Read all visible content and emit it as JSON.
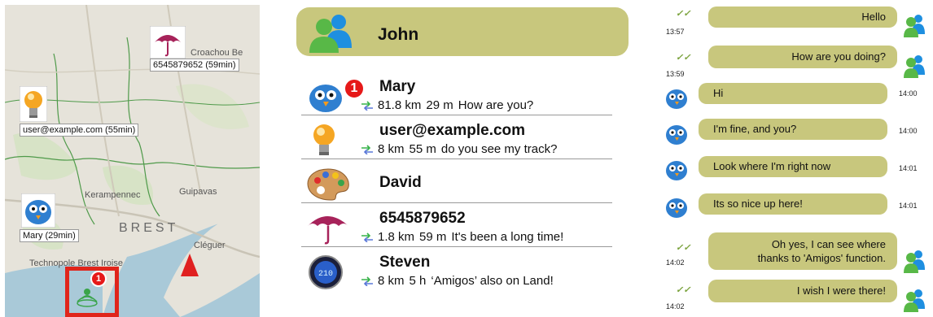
{
  "map": {
    "place_labels": [
      "Croachou Be",
      "Kerampennec",
      "Guipavas",
      "Cléguer",
      "Technopole Brest Iroise"
    ],
    "city": "BREST",
    "pins": [
      {
        "label": "6545879652 (59min)",
        "icon": "umbrella-icon"
      },
      {
        "label": "user@example.com (55min)",
        "icon": "lightbulb-icon"
      },
      {
        "label": "Mary (29min)",
        "icon": "bird-icon"
      }
    ],
    "selected_badge": "1",
    "colors": {
      "accent_red": "#e0251b",
      "border_green": "#2f8a3a"
    }
  },
  "contacts": {
    "header_name": "John",
    "items": [
      {
        "name": "Mary",
        "distance": "81.8 km",
        "time": "29 m",
        "message": "How are you?",
        "badge": "1",
        "icon": "bird-icon"
      },
      {
        "name": "user@example.com",
        "distance": "8 km",
        "time": "55 m",
        "message": "do you see my track?",
        "icon": "lightbulb-icon"
      },
      {
        "name": "David",
        "distance": "",
        "time": "",
        "message": "",
        "icon": "palette-icon"
      },
      {
        "name": "6545879652",
        "distance": "1.8 km",
        "time": "59 m",
        "message": "It's been a long time!",
        "icon": "umbrella-icon"
      },
      {
        "name": "Steven",
        "distance": "8 km",
        "time": "5 h",
        "message": "‘Amigos’ also on Land!",
        "icon": "speedometer-icon"
      }
    ],
    "colors": {
      "header_bg": "#c8c77d"
    }
  },
  "chat": {
    "messages": [
      {
        "dir": "out",
        "text": "Hello",
        "time": "13:57"
      },
      {
        "dir": "out",
        "text": "How are you doing?",
        "time": "13:59"
      },
      {
        "dir": "in",
        "text": "Hi",
        "time": "14:00"
      },
      {
        "dir": "in",
        "text": "I'm fine, and you?",
        "time": "14:00"
      },
      {
        "dir": "in",
        "text": "Look where I'm right now",
        "time": "14:01"
      },
      {
        "dir": "in",
        "text": "Its so nice up here!",
        "time": "14:01"
      },
      {
        "dir": "out",
        "text": "Oh yes, I can see where",
        "text2": "thanks to 'Amigos' function.",
        "time": "14:02"
      },
      {
        "dir": "out",
        "text": "I wish I were there!",
        "time": "14:02"
      }
    ],
    "tick_glyph": "✓✓",
    "colors": {
      "bubble_bg": "#c8c77d"
    }
  }
}
